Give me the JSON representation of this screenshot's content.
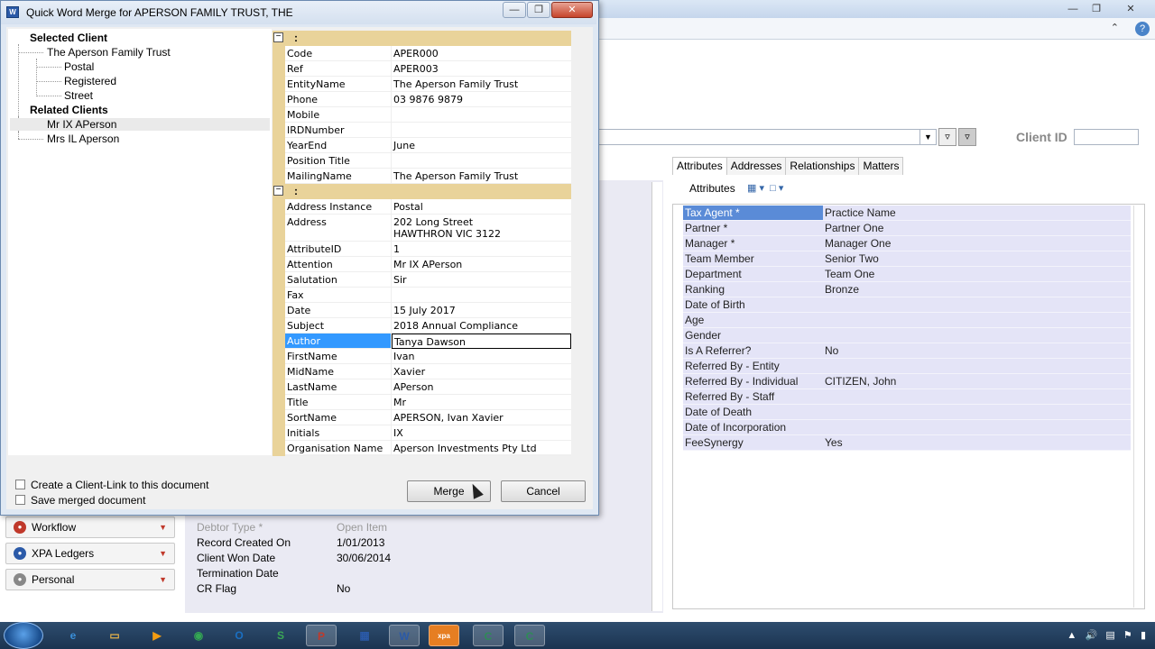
{
  "dialog": {
    "title": "Quick Word Merge for APERSON FAMILY TRUST, THE",
    "tree": {
      "selected_client_heading": "Selected Client",
      "selected_client_name": "The Aperson Family Trust",
      "addresses": [
        "Postal",
        "Registered",
        "Street"
      ],
      "related_clients_heading": "Related Clients",
      "related_clients": [
        "Mr IX APerson",
        "Mrs IL Aperson"
      ]
    },
    "grid": {
      "group_label": ":",
      "group1": [
        {
          "key": "Code",
          "value": "APER000"
        },
        {
          "key": "Ref",
          "value": "APER003"
        },
        {
          "key": "EntityName",
          "value": "The Aperson Family Trust"
        },
        {
          "key": "Phone",
          "value": "03 9876 9879"
        },
        {
          "key": "Mobile",
          "value": ""
        },
        {
          "key": "IRDNumber",
          "value": ""
        },
        {
          "key": "YearEnd",
          "value": "June"
        },
        {
          "key": "Position Title",
          "value": ""
        },
        {
          "key": "MailingName",
          "value": "The Aperson Family Trust"
        }
      ],
      "group2": [
        {
          "key": "Address Instance",
          "value": "Postal"
        },
        {
          "key": "Address",
          "value": "202 Long Street",
          "value2": "HAWTHRON  VIC  3122"
        },
        {
          "key": "AttributeID",
          "value": "1"
        },
        {
          "key": "Attention",
          "value": "Mr IX APerson"
        },
        {
          "key": "Salutation",
          "value": "Sir"
        },
        {
          "key": "Fax",
          "value": ""
        },
        {
          "key": "Date",
          "value": "15 July 2017"
        },
        {
          "key": "Subject",
          "value": "2018 Annual Compliance"
        },
        {
          "key": "Author",
          "value": "Tanya Dawson"
        },
        {
          "key": "FirstName",
          "value": "Ivan"
        },
        {
          "key": "MidName",
          "value": "Xavier"
        },
        {
          "key": "LastName",
          "value": "APerson"
        },
        {
          "key": "Title",
          "value": "Mr"
        },
        {
          "key": "SortName",
          "value": "APERSON, Ivan Xavier"
        },
        {
          "key": "Initials",
          "value": "IX"
        },
        {
          "key": "Organisation Name",
          "value": "Aperson Investments Pty Ltd"
        }
      ]
    },
    "footer": {
      "client_link_label": "Create a Client-Link to this document",
      "save_merged_label": "Save merged document",
      "merge_button": "Merge",
      "cancel_button": "Cancel"
    }
  },
  "background": {
    "client_id_label": "Client ID",
    "tabs": [
      "Attributes",
      "Addresses",
      "Relationships",
      "Matters"
    ],
    "attributes_toolbar_label": "Attributes",
    "attributes": [
      {
        "key": "Tax Agent *",
        "value": "Practice Name"
      },
      {
        "key": "Partner *",
        "value": "Partner One"
      },
      {
        "key": "Manager *",
        "value": "Manager One"
      },
      {
        "key": "Team Member",
        "value": "Senior Two"
      },
      {
        "key": "Department",
        "value": "Team One"
      },
      {
        "key": "Ranking",
        "value": "Bronze"
      },
      {
        "key": "Date of Birth",
        "value": ""
      },
      {
        "key": "Age",
        "value": ""
      },
      {
        "key": "Gender",
        "value": ""
      },
      {
        "key": "Is A Referrer?",
        "value": "No"
      },
      {
        "key": "Referred By - Entity",
        "value": ""
      },
      {
        "key": "Referred By - Individual",
        "value": "CITIZEN, John"
      },
      {
        "key": "Referred By - Staff",
        "value": ""
      },
      {
        "key": "Date of Death",
        "value": ""
      },
      {
        "key": "Date of Incorporation",
        "value": ""
      },
      {
        "key": "FeeSynergy",
        "value": "Yes"
      }
    ],
    "lower_rows": [
      {
        "key": "Debtor Type *",
        "value": "Open Item",
        "dim": true
      },
      {
        "key": "Record Created On",
        "value": "1/01/2013",
        "dim": false
      },
      {
        "key": "Client Won Date",
        "value": "30/06/2014",
        "dim": false
      },
      {
        "key": "Termination Date",
        "value": "",
        "dim": false
      },
      {
        "key": "CR Flag",
        "value": "No",
        "dim": false
      }
    ],
    "nav": [
      "Workflow",
      "XPA Ledgers",
      "Personal"
    ]
  },
  "taskbar": {
    "apps": [
      "ie-icon",
      "explorer-icon",
      "media-icon",
      "chrome-icon",
      "outlook-icon",
      "app-icon",
      "powerpoint-icon",
      "app2-icon",
      "word-icon",
      "xpa-icon",
      "camtasia-icon",
      "camtasia2-icon"
    ]
  }
}
